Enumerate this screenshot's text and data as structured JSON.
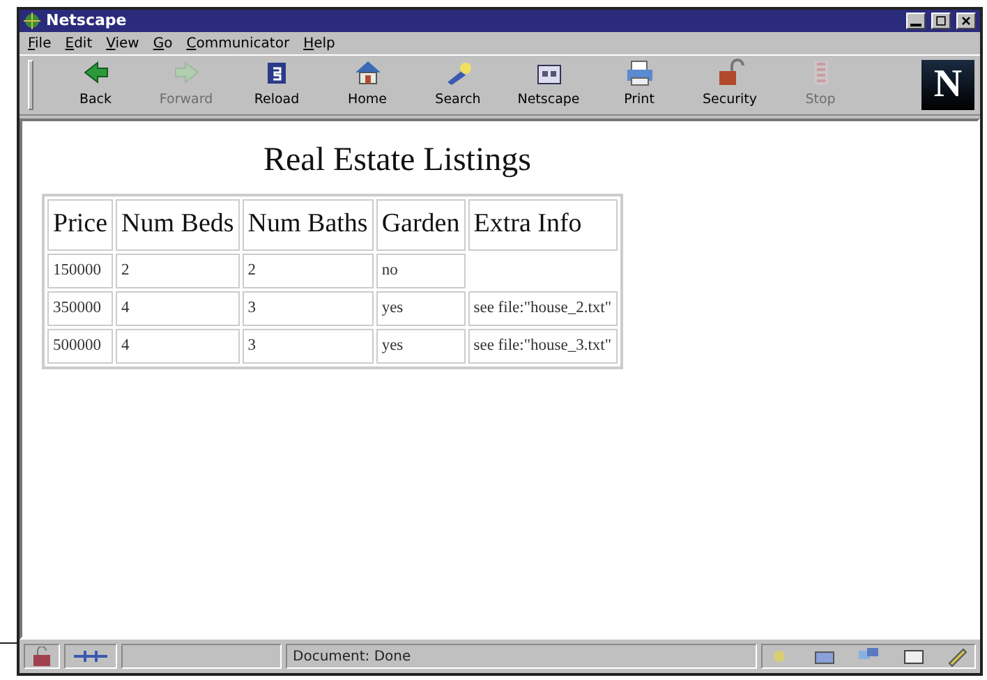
{
  "window": {
    "title": "Netscape"
  },
  "menu": [
    "File",
    "Edit",
    "View",
    "Go",
    "Communicator",
    "Help"
  ],
  "toolbar": [
    {
      "label": "Back",
      "kind": "back",
      "disabled": false
    },
    {
      "label": "Forward",
      "kind": "forward",
      "disabled": true
    },
    {
      "label": "Reload",
      "kind": "reload",
      "disabled": false
    },
    {
      "label": "Home",
      "kind": "home",
      "disabled": false
    },
    {
      "label": "Search",
      "kind": "search",
      "disabled": false
    },
    {
      "label": "Netscape",
      "kind": "netscape",
      "disabled": false
    },
    {
      "label": "Print",
      "kind": "print",
      "disabled": false
    },
    {
      "label": "Security",
      "kind": "security",
      "disabled": false
    },
    {
      "label": "Stop",
      "kind": "stop",
      "disabled": true
    }
  ],
  "logo": {
    "text": "N"
  },
  "page": {
    "heading": "Real Estate Listings",
    "table": {
      "columns": [
        "Price",
        "Num Beds",
        "Num Baths",
        "Garden",
        "Extra Info"
      ],
      "rows": [
        [
          "150000",
          "2",
          "2",
          "no",
          null
        ],
        [
          "350000",
          "4",
          "3",
          "yes",
          "see file:\"house_2.txt\""
        ],
        [
          "500000",
          "4",
          "3",
          "yes",
          "see file:\"house_3.txt\""
        ]
      ]
    }
  },
  "status_bar": {
    "text": "Document: Done"
  }
}
